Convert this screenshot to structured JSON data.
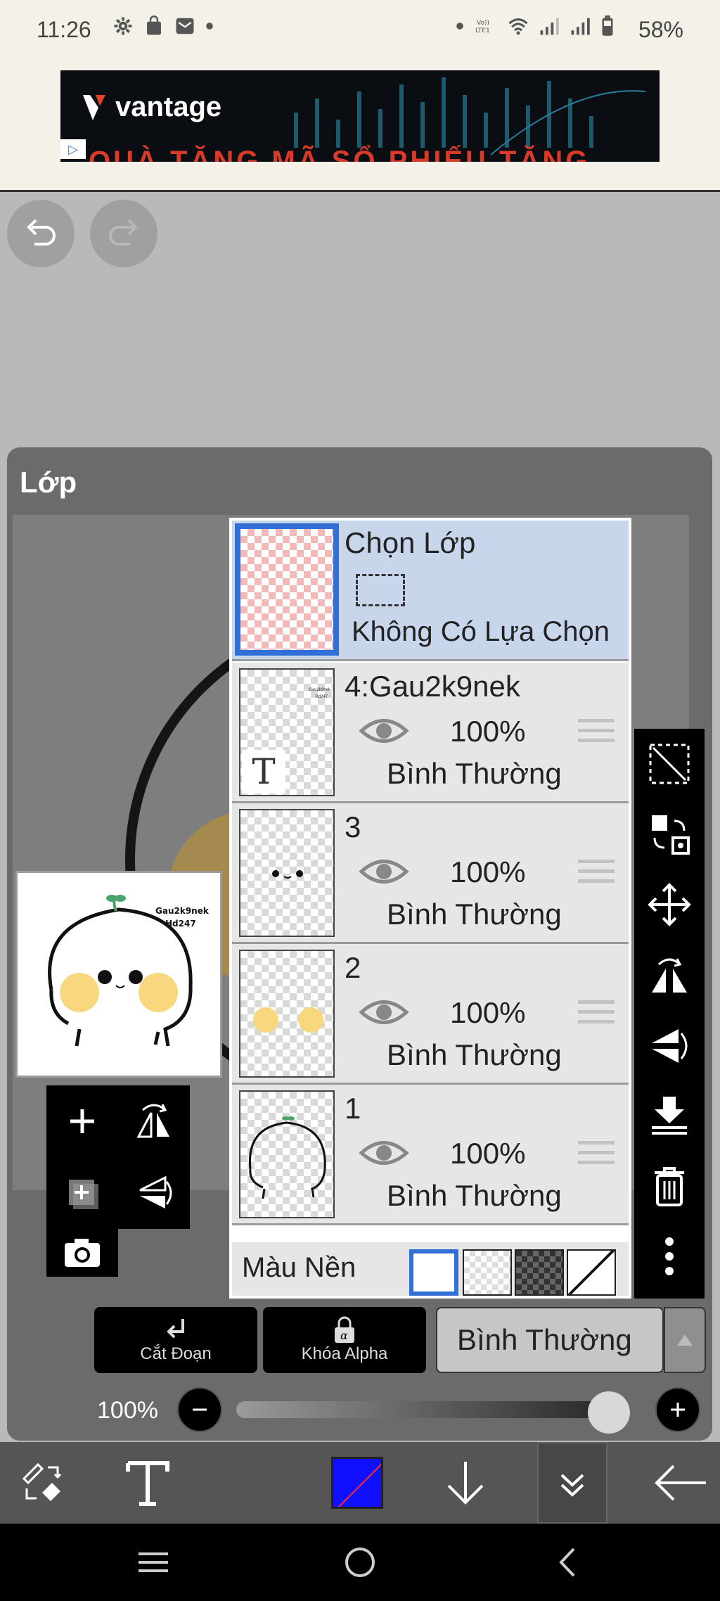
{
  "status_bar": {
    "time": "11:26",
    "battery": "58%",
    "icons": [
      "settings-icon",
      "shop-icon",
      "mail-icon",
      "dot-icon",
      "dot-icon",
      "volte-icon",
      "wifi-icon",
      "signal-icon",
      "signal-icon",
      "battery-icon"
    ]
  },
  "ad": {
    "brand": "vantage",
    "strip_text": "QUÀ TẶNG MÃ SỔ PHIẾU TẶNG",
    "badge": "▷"
  },
  "panel": {
    "title": "Lớp"
  },
  "preview": {
    "watermark_line1": "Gau2k9nek",
    "watermark_line2": "Hd247"
  },
  "selection_layer": {
    "title": "Chọn Lớp",
    "status": "Không Có Lựa Chọn"
  },
  "layers": [
    {
      "name": "4:Gau2k9nek",
      "opacity": "100%",
      "blend": "Bình Thường",
      "thumb_label": "T"
    },
    {
      "name": "3",
      "opacity": "100%",
      "blend": "Bình Thường"
    },
    {
      "name": "2",
      "opacity": "100%",
      "blend": "Bình Thường"
    },
    {
      "name": "1",
      "opacity": "100%",
      "blend": "Bình Thường"
    }
  ],
  "background": {
    "label": "Màu Nền",
    "options": [
      "white",
      "transparent",
      "dark-checker",
      "none"
    ],
    "selected": "white"
  },
  "buttons": {
    "clip": "Cắt Đoạn",
    "alpha_lock": "Khóa Alpha",
    "blend_mode": "Bình Thường"
  },
  "opacity_slider": {
    "label": "100%",
    "value": 1.0
  },
  "toolbar": {
    "color": "#1010ff"
  }
}
